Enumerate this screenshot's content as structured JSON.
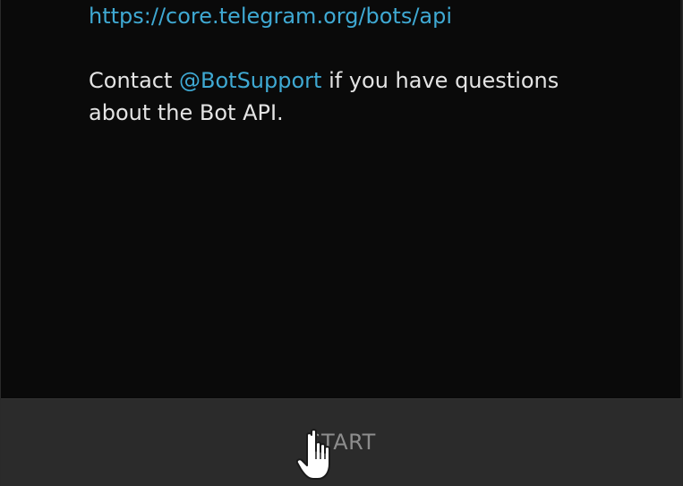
{
  "message": {
    "url": "https://core.telegram.org/bots/api",
    "contact_prefix": "Contact ",
    "contact_handle": "@BotSupport",
    "contact_suffix": " if you have questions about the Bot API."
  },
  "bottom_bar": {
    "start_label": "START"
  },
  "colors": {
    "background": "#0a0a0a",
    "text": "#e4e4e4",
    "link": "#3fa9d3",
    "bar": "#2b2b2b",
    "button_text": "#8d8d8d"
  },
  "icons": {
    "cursor": "hand-pointer-icon"
  }
}
